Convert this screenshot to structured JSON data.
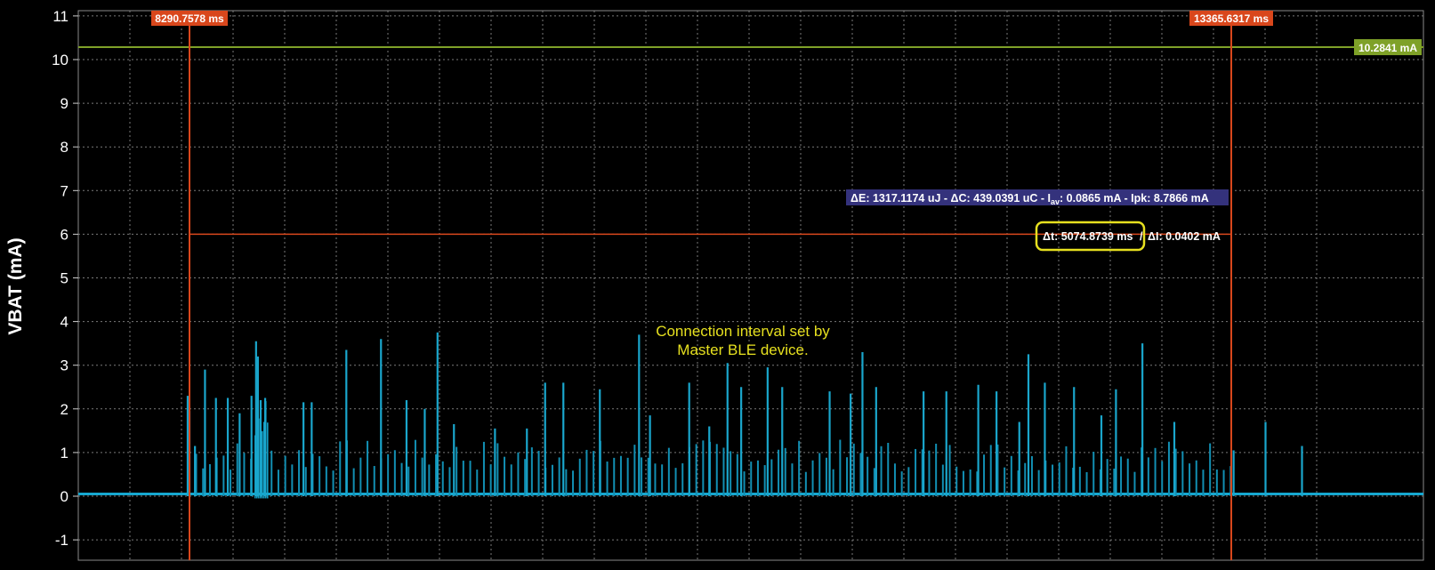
{
  "chart_data": {
    "type": "line",
    "ylabel": "VBAT (mA)",
    "ylim": [
      -1.1,
      11.3
    ],
    "yticks": [
      "11",
      "10",
      "9",
      "8",
      "7",
      "6",
      "5",
      "4",
      "3",
      "2",
      "1",
      "0",
      "-1"
    ],
    "grid": true,
    "cursors": [
      {
        "label": "8290.7578 ms",
        "position_ms": 8290.7578
      },
      {
        "label": "13365.6317 ms",
        "position_ms": 13365.6317
      }
    ],
    "peak_marker": {
      "label": "10.2841 mA",
      "value": 10.2841
    },
    "measurement": {
      "summary": "ΔE: 1317.1174 uJ - ΔC: 439.0391 uC - I",
      "summary_sub": "av",
      "summary_tail": ": 0.0865 mA - Ipk: 8.7866 mA",
      "delta_t": "Δt: 5074.8739 ms",
      "delta_i": "ΔI: 0.0402 mA",
      "level": 6.0
    },
    "annotation": [
      "Connection interval set by",
      "Master BLE device."
    ],
    "series": [
      {
        "baseline": 0.05,
        "peaks": [
          [
            -0.02,
            2.3
          ],
          [
            0.0,
            1.95
          ],
          [
            0.06,
            1.15
          ],
          [
            0.17,
            2.9
          ],
          [
            0.29,
            2.25
          ],
          [
            0.42,
            2.25
          ],
          [
            0.55,
            1.9
          ],
          [
            0.68,
            2.3
          ],
          [
            0.73,
            3.55
          ],
          [
            0.75,
            3.2
          ],
          [
            0.78,
            2.2
          ],
          [
            0.83,
            2.25
          ],
          [
            1.25,
            2.15
          ],
          [
            1.34,
            2.15
          ],
          [
            1.72,
            3.35
          ],
          [
            2.1,
            3.6
          ],
          [
            2.38,
            2.2
          ],
          [
            2.58,
            2.0
          ],
          [
            2.72,
            3.75
          ],
          [
            2.9,
            1.65
          ],
          [
            3.35,
            1.55
          ],
          [
            3.7,
            1.55
          ],
          [
            3.9,
            2.6
          ],
          [
            4.1,
            2.6
          ],
          [
            4.5,
            2.45
          ],
          [
            4.93,
            3.7
          ],
          [
            5.05,
            1.85
          ],
          [
            5.48,
            2.6
          ],
          [
            5.7,
            1.6
          ],
          [
            5.9,
            3.05
          ],
          [
            6.05,
            2.5
          ],
          [
            6.34,
            2.95
          ],
          [
            6.5,
            2.5
          ],
          [
            7.02,
            2.4
          ],
          [
            7.25,
            2.35
          ],
          [
            7.38,
            3.3
          ],
          [
            7.53,
            2.5
          ],
          [
            8.05,
            2.4
          ],
          [
            8.3,
            2.4
          ],
          [
            8.65,
            2.55
          ],
          [
            8.85,
            2.4
          ],
          [
            9.1,
            1.7
          ],
          [
            9.2,
            3.25
          ],
          [
            9.38,
            2.6
          ],
          [
            9.7,
            2.5
          ],
          [
            10.0,
            1.85
          ],
          [
            10.16,
            2.45
          ],
          [
            10.45,
            3.5
          ],
          [
            10.8,
            1.7
          ],
          [
            11.45,
            1.05
          ],
          [
            11.8,
            1.7
          ],
          [
            12.2,
            1.15
          ]
        ]
      }
    ]
  }
}
